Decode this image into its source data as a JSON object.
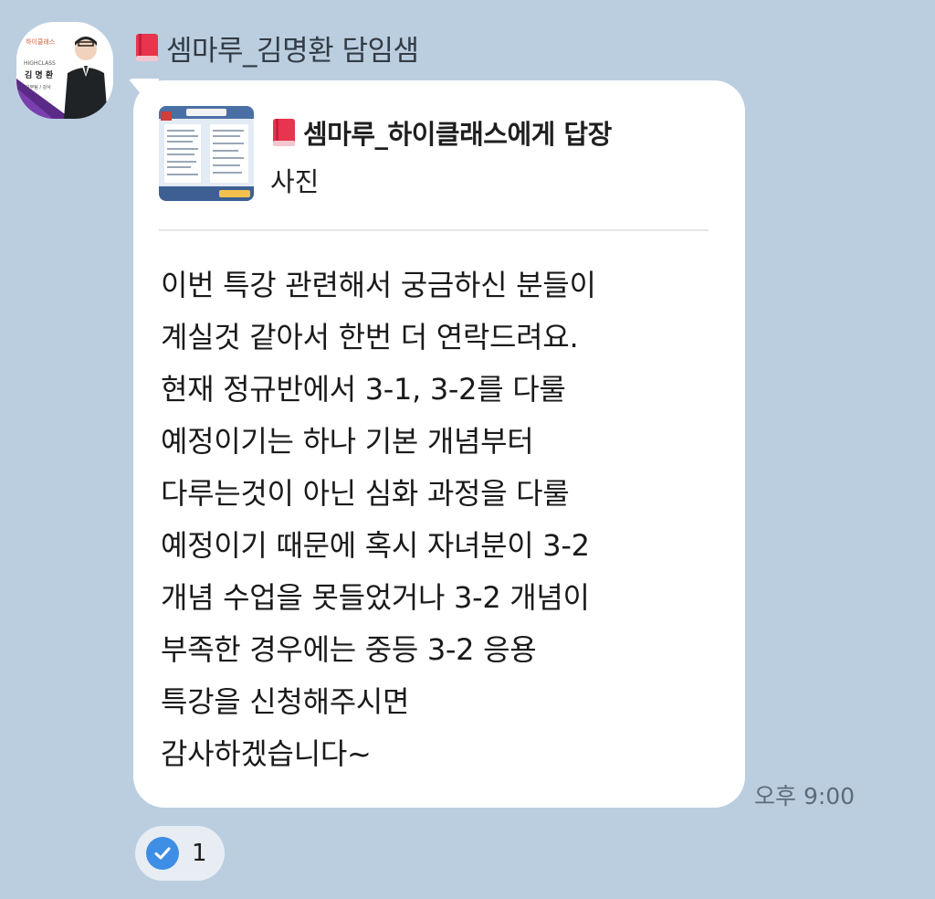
{
  "chat": {
    "sender_name": "셈마루_김명환 담임샘",
    "avatar": {
      "icon": "profile-photo",
      "badge_lines": [
        "HIGHCLASS",
        "김 명 환",
        "교무팀 / 강사"
      ]
    }
  },
  "message": {
    "reply": {
      "icon": "book-icon",
      "title": "셈마루_하이클래스에게 답장",
      "subtitle": "사진",
      "thumbnail_icon": "document-thumbnail"
    },
    "body": "이번 특강 관련해서 궁금하신 분들이\n계실것 같아서 한번 더 연락드려요.\n현재 정규반에서 3-1, 3-2를 다룰\n예정이기는 하나 기본 개념부터\n다루는것이 아닌 심화 과정을 다룰\n예정이기 때문에 혹시 자녀분이 3-2\n개념 수업을 못들었거나 3-2 개념이\n부족한 경우에는 중등 3-2 응용\n특강을 신청해주시면\n감사하겠습니다~",
    "time": "오후 9:00"
  },
  "reaction": {
    "icon": "check-icon",
    "count": "1"
  },
  "colors": {
    "background": "#bacee0",
    "bubble": "#ffffff",
    "check": "#3f8ee5",
    "book": "#e8344e"
  }
}
